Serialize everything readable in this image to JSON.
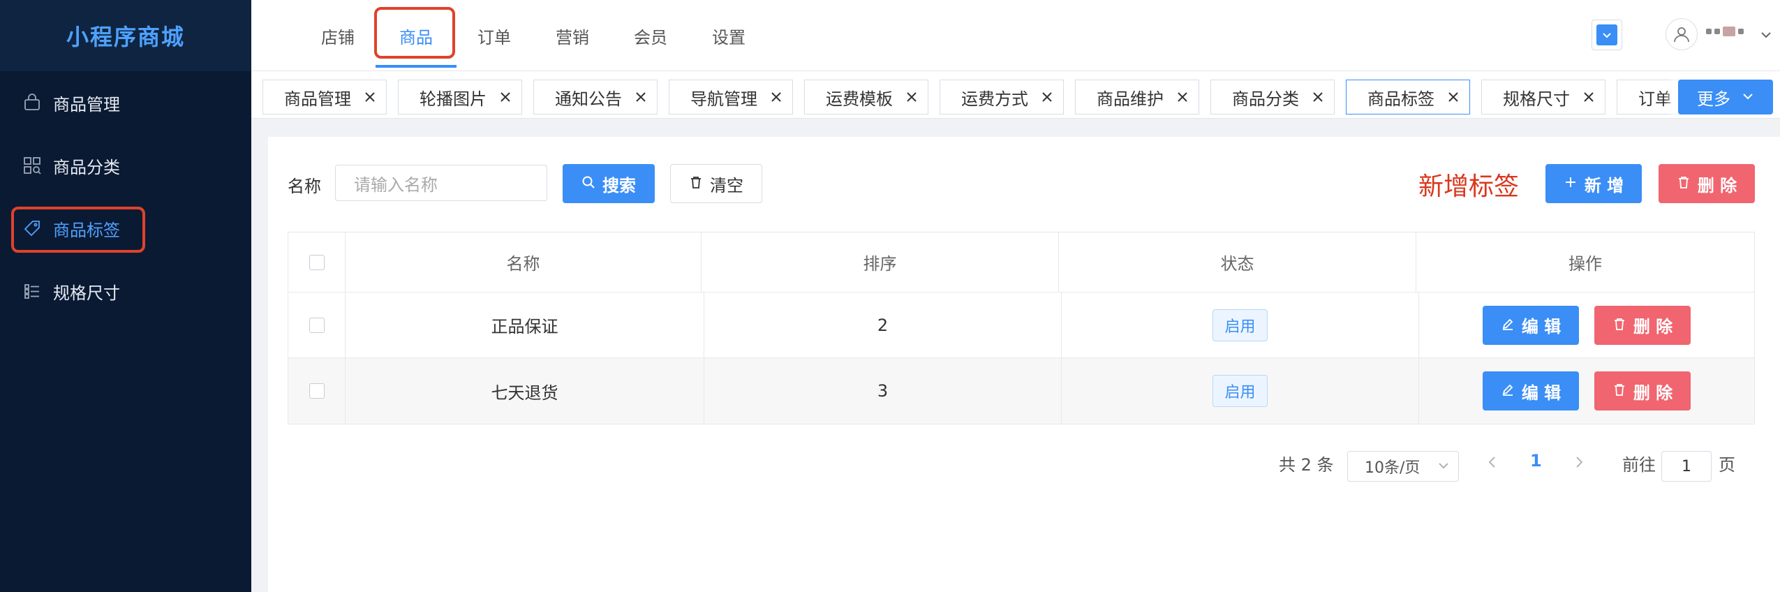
{
  "app": {
    "logo": "小程序商城"
  },
  "sidebar": {
    "items": [
      {
        "label": "商品管理",
        "icon": "shopping-bag-icon"
      },
      {
        "label": "商品分类",
        "icon": "category-grid-icon"
      },
      {
        "label": "商品标签",
        "icon": "tag-icon",
        "active": true
      },
      {
        "label": "规格尺寸",
        "icon": "list-icon"
      }
    ]
  },
  "topnav": {
    "items": [
      "店铺",
      "商品",
      "订单",
      "营销",
      "会员",
      "设置"
    ],
    "active": "商品",
    "user_icon": "user-icon"
  },
  "tabs": {
    "items": [
      "商品管理",
      "轮播图片",
      "通知公告",
      "导航管理",
      "运费模板",
      "运费方式",
      "商品维护",
      "商品分类",
      "商品标签",
      "规格尺寸",
      "订单"
    ],
    "active": "商品标签",
    "more_label": "更多"
  },
  "filter": {
    "name_label": "名称",
    "name_placeholder": "请输入名称",
    "search_label": "搜索",
    "clear_label": "清空"
  },
  "annotation": "新增标签",
  "actions": {
    "add_label": "新 增",
    "delete_label": "删 除"
  },
  "table": {
    "headers": [
      "名称",
      "排序",
      "状态",
      "操作"
    ],
    "rows": [
      {
        "name": "正品保证",
        "sort": "2",
        "status": "启用"
      },
      {
        "name": "七天退货",
        "sort": "3",
        "status": "启用"
      }
    ],
    "edit_label": "编 辑",
    "delete_label": "删 除"
  },
  "pagination": {
    "total": "共 2 条",
    "page_size": "10条/页",
    "current_page": "1",
    "goto_label": "前往",
    "goto_value": "1",
    "page_suffix": "页"
  },
  "colors": {
    "primary": "#3a8ef6",
    "danger": "#f0656f",
    "sidebar_bg": "#0b1a33",
    "annotation": "#d9381e"
  }
}
